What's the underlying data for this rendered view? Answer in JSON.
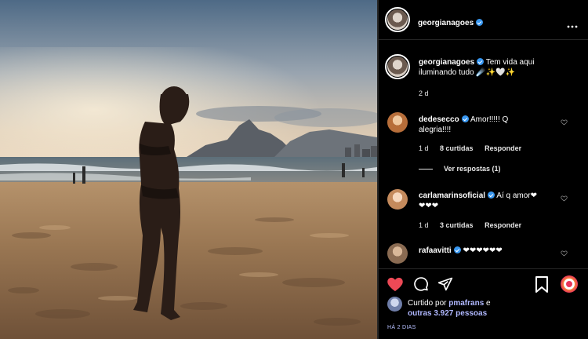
{
  "post": {
    "username": "georgianagoes",
    "caption": "Tem vida aqui iluminando tudo 🔭✨🤍✨",
    "caption_line1": "Tem vida aqui",
    "caption_line2": "iluminando tudo ☄️✨🤍✨",
    "age": "2 d"
  },
  "comments": [
    {
      "username": "dedesecco",
      "text_line1": "Amor!!!!! Q",
      "text_line2": "alegria!!!!",
      "age": "1 d",
      "likes": "8 curtidas",
      "reply": "Responder",
      "view_replies": "Ver respostas (1)"
    },
    {
      "username": "carlamarinsoficial",
      "text_line1": "Aí q amor❤",
      "text_line2": "❤❤❤",
      "age": "1 d",
      "likes": "3 curtidas",
      "reply": "Responder"
    },
    {
      "username": "rafaavitti",
      "text_line1": "❤❤❤❤❤❤",
      "age": "",
      "likes": "",
      "reply": ""
    }
  ],
  "likes": {
    "prefix": "Curtido por",
    "user": "pmafrans",
    "connector": "e",
    "others": "outras 3.927 pessoas"
  },
  "timestamp": "HÁ 2 DIAS",
  "icons": {
    "more": "more-options-icon",
    "like": "heart-filled-icon",
    "comment": "comment-icon",
    "share": "paper-plane-icon",
    "save": "bookmark-icon"
  },
  "colors": {
    "background": "#000000",
    "like_red": "#ed4956",
    "verified_blue": "#3897f0",
    "divider": "#262626"
  }
}
